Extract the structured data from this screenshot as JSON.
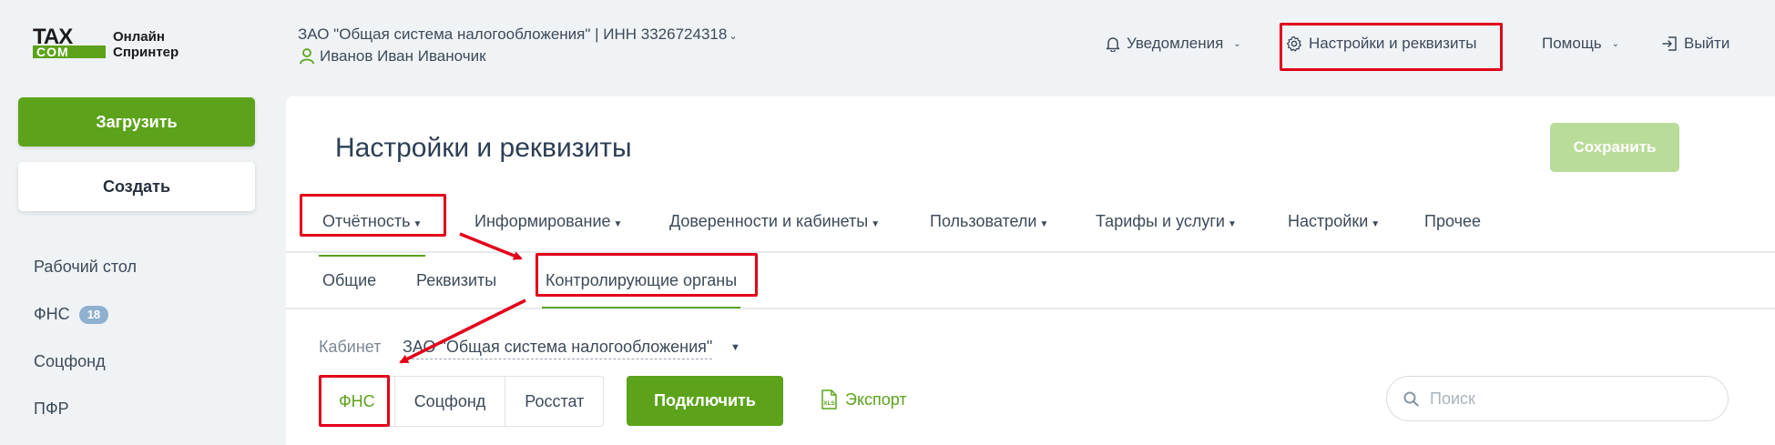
{
  "logo": {
    "mark_top": "TAX",
    "mark_bottom": "COM",
    "line1": "Онлайн",
    "line2": "Спринтер"
  },
  "header": {
    "org": "ЗАО \"Общая система налогообложения\" | ИНН 3326724318",
    "user": "Иванов Иван Иваночик",
    "notifications": "Уведомления",
    "settings": "Настройки и реквизиты",
    "help": "Помощь",
    "logout": "Выйти"
  },
  "sidebar": {
    "upload": "Загрузить",
    "create": "Создать",
    "items": [
      {
        "label": "Рабочий стол"
      },
      {
        "label": "ФНС",
        "badge": "18"
      },
      {
        "label": "Соцфонд"
      },
      {
        "label": "ПФР"
      }
    ]
  },
  "main": {
    "title": "Настройки и реквизиты",
    "save": "Сохранить",
    "tabs": [
      "Отчётность",
      "Информирование",
      "Доверенности и кабинеты",
      "Пользователи",
      "Тарифы и услуги",
      "Настройки",
      "Прочее"
    ],
    "subtabs": [
      "Общие",
      "Реквизиты",
      "Контролирующие органы"
    ],
    "cabinet_label": "Кабинет",
    "cabinet_value": "ЗАО \"Общая система налогообложения\"",
    "segments": [
      "ФНС",
      "Соцфонд",
      "Росстат"
    ],
    "connect": "Подключить",
    "export": "Экспорт",
    "search_placeholder": "Поиск"
  },
  "colors": {
    "accent": "#5ca31b",
    "highlight": "#e2001a",
    "background": "#f0f3f6"
  }
}
